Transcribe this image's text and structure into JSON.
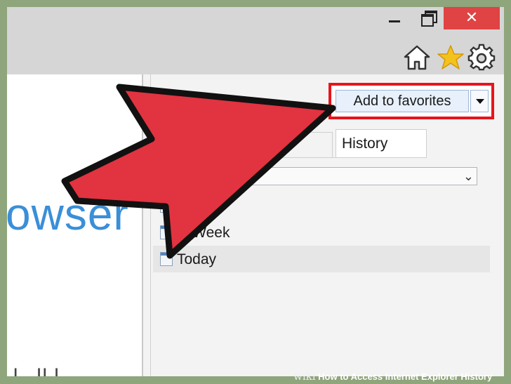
{
  "window": {
    "minimize_icon": "minimize-icon",
    "maximize_icon": "restore-icon",
    "close_label": "✕",
    "toolbar_icons": [
      "home-icon",
      "star-icon",
      "gear-icon"
    ]
  },
  "page": {
    "partial_word": "owser",
    "bottom_partial_text": "ı . ıı ı"
  },
  "favorites_center": {
    "add_button_label": "Add to favorites",
    "dropdown_icon": "dropdown-arrow-icon",
    "tabs": [
      {
        "label": ""
      },
      {
        "label": "History"
      }
    ],
    "view_select_value": "",
    "history_items": [
      {
        "label": "s Ago",
        "selected": false
      },
      {
        "label": "st Week",
        "selected": false
      },
      {
        "label": "Today",
        "selected": true
      }
    ]
  },
  "annotation": {
    "arrow_color": "#e23340",
    "highlight_color": "#e8141c"
  },
  "footer": {
    "brand": "wiki",
    "title": "How to Access Internet Explorer History"
  }
}
